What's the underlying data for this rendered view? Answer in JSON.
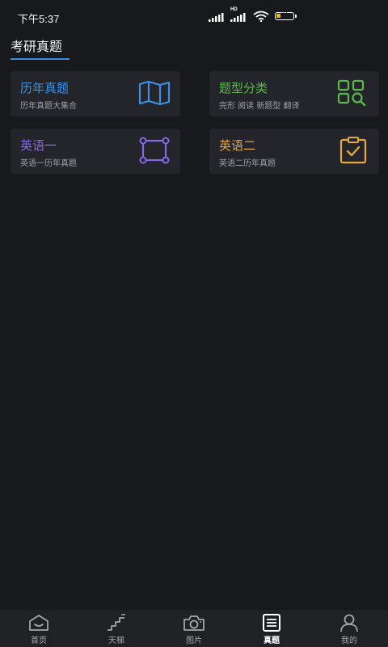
{
  "status_bar": {
    "time": "下午5:37",
    "network_badge": "HD",
    "battery_level": "27"
  },
  "header": {
    "title": "考研真题",
    "accent_color": "#3a8de0"
  },
  "cards": [
    {
      "title": "历年真题",
      "subtitle": "历年真题大集合",
      "color": "#3d8fe0",
      "icon": "map-icon"
    },
    {
      "title": "题型分类",
      "subtitle": "完形 阅读 新题型 翻译",
      "color": "#5bb84a",
      "icon": "grid-search-icon"
    },
    {
      "title": "英语一",
      "subtitle": "英语一历年真题",
      "color": "#8a67e8",
      "icon": "vector-square-icon"
    },
    {
      "title": "英语二",
      "subtitle": "英语二历年真题",
      "color": "#e3a640",
      "icon": "clipboard-check-icon"
    }
  ],
  "bottom_nav": {
    "items": [
      {
        "label": "首页",
        "icon": "home-icon",
        "active": false
      },
      {
        "label": "天梯",
        "icon": "stairs-icon",
        "active": false
      },
      {
        "label": "图片",
        "icon": "camera-icon",
        "active": false
      },
      {
        "label": "真题",
        "icon": "list-icon",
        "active": true
      },
      {
        "label": "我的",
        "icon": "user-icon",
        "active": false
      }
    ]
  }
}
